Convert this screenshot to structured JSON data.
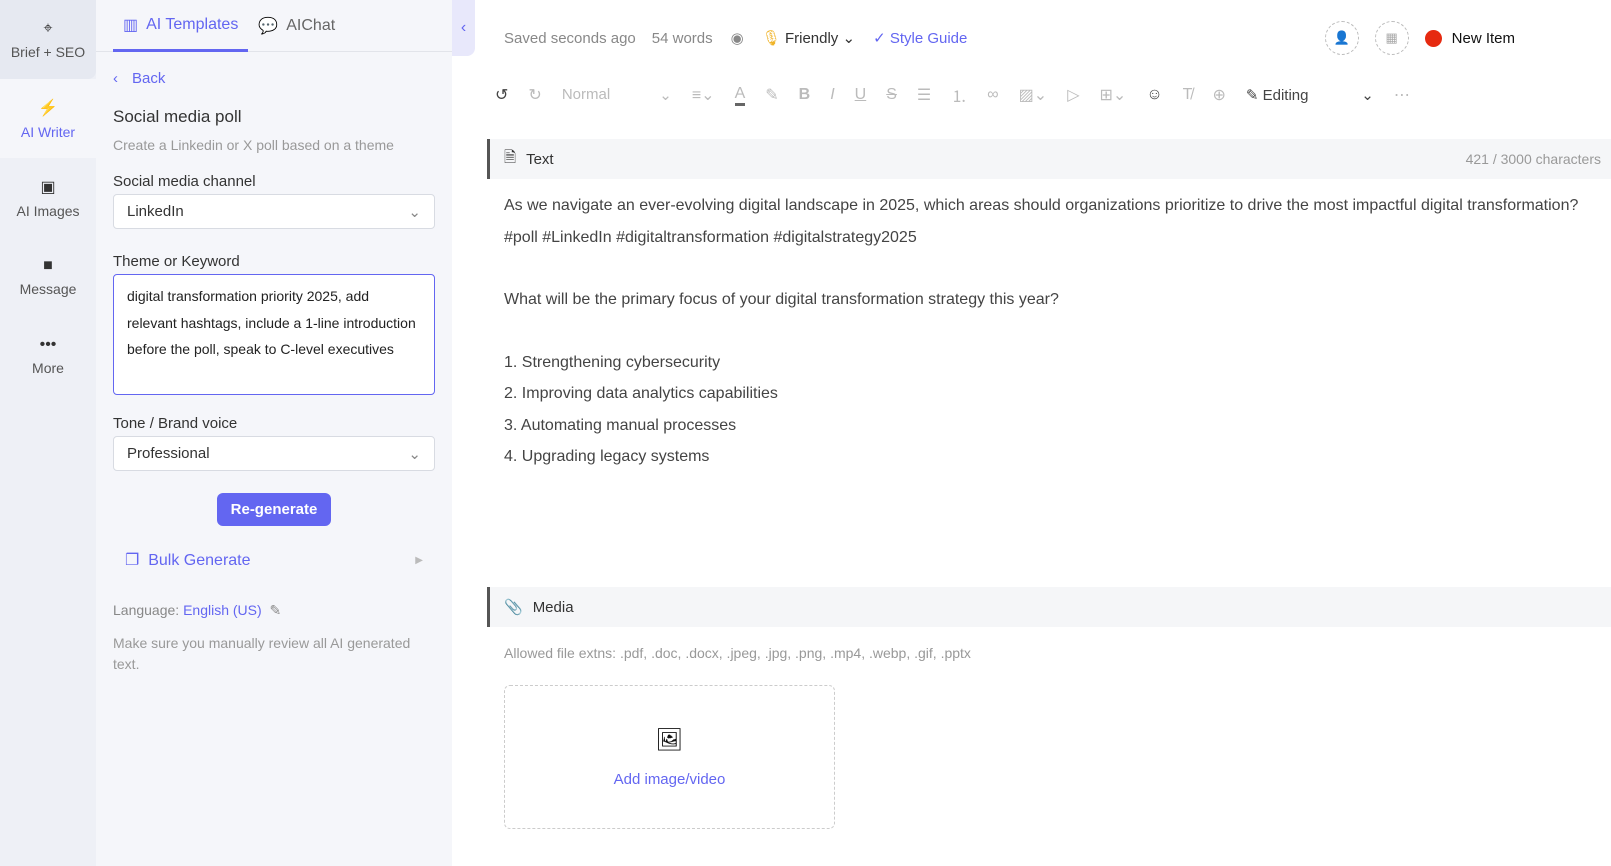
{
  "rail": [
    {
      "label": "Brief + SEO",
      "icon": "crosshair-icon"
    },
    {
      "label": "AI Writer",
      "icon": "bolt-icon"
    },
    {
      "label": "AI Images",
      "icon": "image-icon"
    },
    {
      "label": "Message",
      "icon": "message-icon"
    },
    {
      "label": "More",
      "icon": "more-icon"
    }
  ],
  "panel": {
    "tabs": [
      "AI Templates",
      "AIChat"
    ],
    "back": "Back",
    "title": "Social media poll",
    "subtitle": "Create a Linkedin or X poll based on a theme",
    "channel_label": "Social media channel",
    "channel_value": "LinkedIn",
    "theme_label": "Theme or Keyword",
    "theme_value": "digital transformation priority 2025, add relevant hashtags, include a 1-line introduction before the poll, speak to C-level executives",
    "tone_label": "Tone / Brand voice",
    "tone_value": "Professional",
    "regen": "Re-generate",
    "bulk": "Bulk Generate",
    "lang_label": "Language:",
    "lang_value": "English (US)",
    "note": "Make sure you manually review all AI generated text."
  },
  "topbar": {
    "saved": "Saved seconds ago",
    "words": "54 words",
    "tone": "Friendly",
    "style_guide": "Style Guide",
    "new_item": "New Item",
    "accent": "#6366f1",
    "status_color": "#e62a10"
  },
  "toolbar": {
    "style": "Normal",
    "mode": "Editing"
  },
  "text_section": {
    "title": "Text",
    "count": "421 / 3000 characters",
    "paragraphs": [
      "As we navigate an ever-evolving digital landscape in 2025, which areas should organizations prioritize to drive the most impactful digital transformation?",
      "#poll #LinkedIn #digitaltransformation #digitalstrategy2025",
      "What will be the primary focus of your digital transformation strategy this year?",
      "1. Strengthening cybersecurity",
      "2. Improving data analytics capabilities",
      "3. Automating manual processes",
      "4. Upgrading legacy systems"
    ]
  },
  "media": {
    "title": "Media",
    "allowed": "Allowed file extns: .pdf, .doc, .docx, .jpeg, .jpg, .png, .mp4, .webp, .gif, .pptx",
    "add": "Add image/video"
  }
}
